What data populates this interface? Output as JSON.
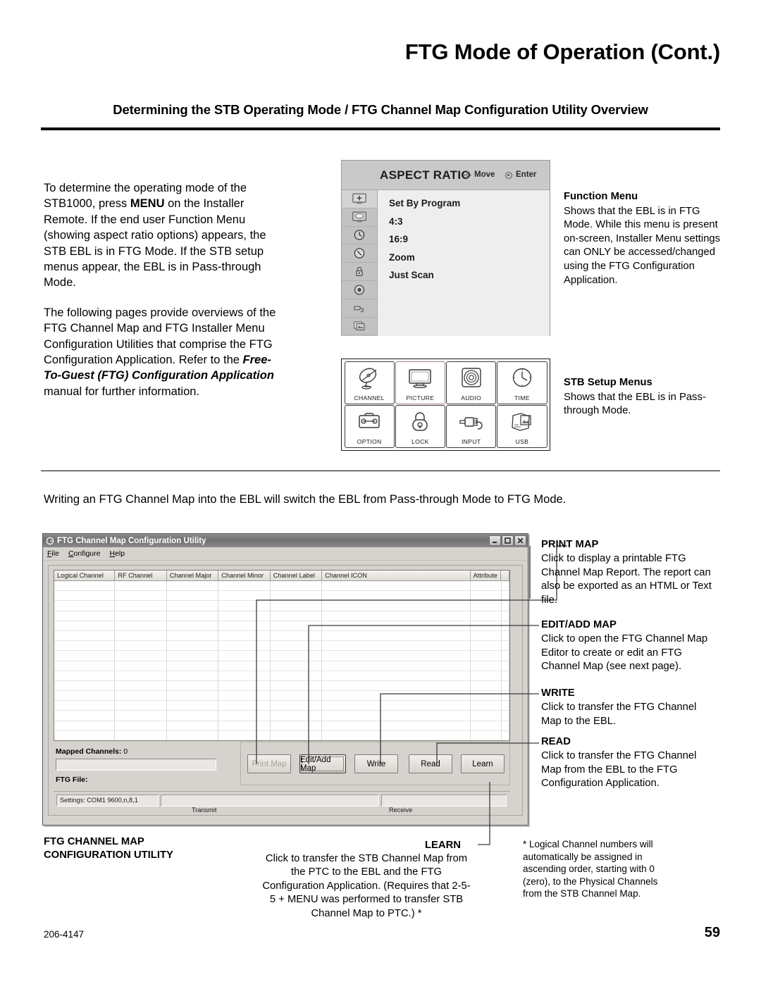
{
  "header": {
    "page_title": "FTG Mode of Operation (Cont.)",
    "section_title": "Determining the STB Operating Mode / FTG Channel Map Configuration Utility Overview"
  },
  "left_body": {
    "para1_a": "To determine the operating mode of the STB1000, press ",
    "para1_menu": "MENU",
    "para1_b": " on the Installer Remote. If the end user Function Menu (showing aspect ratio options) appears, the STB EBL is in FTG Mode. If the STB setup menus appear, the EBL is in Pass-through Mode.",
    "para2_a": "The following pages provide overviews of the FTG Channel Map and FTG Installer Menu Configuration Utilities that comprise the FTG Configuration Application. Refer to the ",
    "para2_em": "Free-To-Guest (FTG) Configuration Application",
    "para2_b": " manual for further information."
  },
  "osd": {
    "title": "ASPECT RATIO",
    "hint_move": "Move",
    "hint_enter": "Enter",
    "items": [
      "Set By Program",
      "4:3",
      "16:9",
      "Zoom",
      "Just Scan"
    ],
    "rail_icons": [
      "picture-plus-icon",
      "caption-icon",
      "timer-icon",
      "clock-icon",
      "lock-icon",
      "audio-dial-icon",
      "input-plug-icon",
      "media-photos-icon"
    ]
  },
  "stb_grid": {
    "cells": [
      {
        "label": "CHANNEL",
        "icon": "satellite-dish-icon"
      },
      {
        "label": "PICTURE",
        "icon": "tv-monitor-icon"
      },
      {
        "label": "AUDIO",
        "icon": "speaker-icon"
      },
      {
        "label": "TIME",
        "icon": "clock-icon"
      },
      {
        "label": "OPTION",
        "icon": "toolbox-wrench-icon"
      },
      {
        "label": "LOCK",
        "icon": "padlock-icon"
      },
      {
        "label": "INPUT",
        "icon": "rca-plug-icon"
      },
      {
        "label": "USB",
        "icon": "photo-stack-icon"
      }
    ]
  },
  "callouts": {
    "function_menu": {
      "heading": "Function Menu",
      "body": "Shows that the EBL is in FTG Mode. While this menu is present on-screen, Installer Menu settings can ONLY be accessed/changed using the FTG Configuration Application."
    },
    "stb_setup_menus": {
      "heading": "STB Setup Menus",
      "body": "Shows that the EBL is in Pass-through Mode."
    }
  },
  "mid_paragraph": "Writing an FTG Channel Map into the EBL will switch the EBL from Pass-through Mode to FTG Mode.",
  "utility_window": {
    "title": "FTG Channel Map Configuration Utility",
    "title_icon": "app-icon",
    "window_buttons": [
      "minimize-button",
      "maximize-button",
      "close-button"
    ],
    "menu": [
      {
        "label": "File",
        "mnemonic": "F"
      },
      {
        "label": "Configure",
        "mnemonic": "C"
      },
      {
        "label": "Help",
        "mnemonic": "H"
      }
    ],
    "grid_columns": [
      "Logical Channel",
      "RF Channel",
      "Channel Major",
      "Channel Minor",
      "Channel Label",
      "Channel ICON",
      "Attribute",
      ""
    ],
    "mapped_channels_label": "Mapped Channels:",
    "mapped_channels_value": "0",
    "ftg_file_label": "FTG File:",
    "buttons": [
      {
        "label": "Print Map",
        "state": "disabled"
      },
      {
        "label": "Edit/Add Map",
        "state": "focused"
      },
      {
        "label": "Write",
        "state": "normal"
      },
      {
        "label": "Read",
        "state": "normal"
      },
      {
        "label": "Learn",
        "state": "normal"
      }
    ],
    "status": {
      "settings": "Settings: COM1 9600,n,8,1",
      "transmit_label": "Transmit",
      "receive_label": "Receive"
    }
  },
  "utility_callouts": {
    "print_map": {
      "heading": "PRINT MAP",
      "body": "Click to display a printable FTG Channel Map Report. The report can also be exported as an HTML or Text file."
    },
    "edit_add_map": {
      "heading": "EDIT/ADD MAP",
      "body": "Click to open the FTG Channel Map Editor to create or edit an FTG Channel Map (see next page)."
    },
    "write": {
      "heading": "WRITE",
      "body": "Click to transfer the FTG Channel Map to the EBL."
    },
    "read": {
      "heading": "READ",
      "body": "Click to transfer the FTG Channel Map from the EBL to the FTG Configuration Application."
    },
    "learn": {
      "heading": "LEARN",
      "body": "Click to transfer the STB Channel Map from the PTC to the EBL and the FTG Configuration Application. (Requires that 2-5-5 + MENU was performed to transfer STB Channel Map to PTC.) *"
    },
    "utility_label": "FTG CHANNEL MAP CONFIGURATION UTILITY",
    "footnote": "* Logical Channel numbers will automatically be assigned in ascending order, starting with 0 (zero), to the Physical Channels from the STB Channel Map."
  },
  "footer": {
    "code": "206-4147",
    "page": "59"
  },
  "colors": {
    "ink": "#000000",
    "osd_header": "#c9c9c9",
    "osd_body": "#eeeeee",
    "window_chrome": "#d6d3ce"
  }
}
